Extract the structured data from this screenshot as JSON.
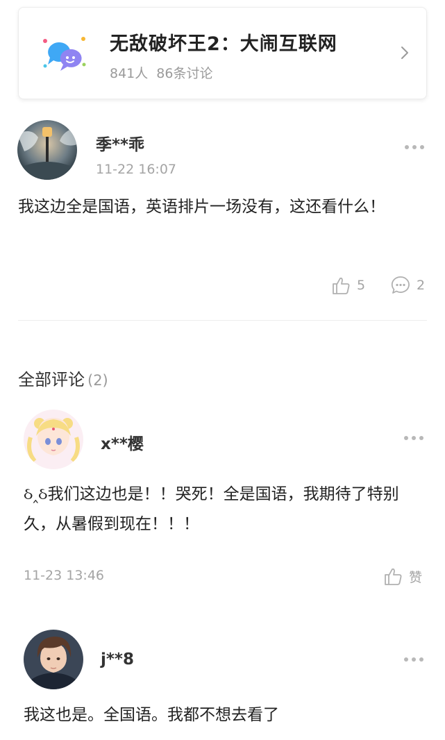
{
  "topic": {
    "title": "无敌破坏王2：大闹互联网",
    "members": "841人",
    "discussions": "86条讨论"
  },
  "post": {
    "username": "季**乖",
    "time": "11-22 16:07",
    "content": "我这边全是国语，英语排片一场没有，这还看什么！",
    "likes": "5",
    "comments": "2"
  },
  "comments_section": {
    "title": "全部评论",
    "count": "(2)"
  },
  "comments": [
    {
      "username": "x**樱",
      "content": "ઠ‸ઠ我们这边也是！！哭死！全是国语，我期待了特别久，从暑假到现在！！！",
      "time": "11-23 13:46",
      "like_label": "赞"
    },
    {
      "username": "j**8",
      "content": "我这也是。全国语。我都不想去看了"
    }
  ],
  "colors": {
    "accent_blue": "#3fa8f5",
    "accent_purple": "#8f84f2",
    "muted_text": "#a4a4a4"
  },
  "icons": [
    "chat-bubbles-icon",
    "chevron-right-icon",
    "more-dots-icon",
    "thumbs-up-icon",
    "comment-bubble-icon"
  ]
}
